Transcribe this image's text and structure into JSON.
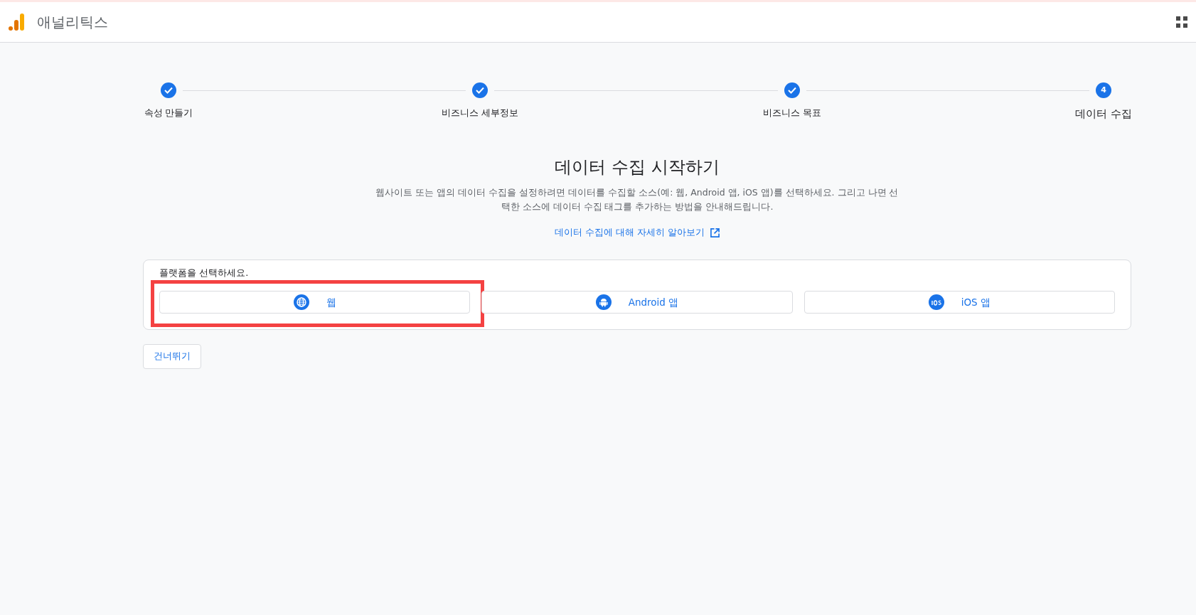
{
  "header": {
    "title": "애널리틱스"
  },
  "steps": [
    {
      "label": "속성 만들기",
      "done": true
    },
    {
      "label": "비즈니스 세부정보",
      "done": true
    },
    {
      "label": "비즈니스 목표",
      "done": true
    },
    {
      "label": "데이터 수집",
      "done": false,
      "number": "4"
    }
  ],
  "intro": {
    "title": "데이터 수집 시작하기",
    "description": "웹사이트 또는 앱의 데이터 수집을 설정하려면 데이터를 수집할 소스(예: 웹, Android 앱, iOS 앱)를 선택하세요. 그리고 나면 선택한 소스에 데이터 수집 태그를 추가하는 방법을 안내해드립니다.",
    "link": "데이터 수집에 대해 자세히 알아보기"
  },
  "platform_card": {
    "label": "플랫폼을 선택하세요.",
    "platforms": [
      {
        "label": "웹",
        "kind": "web",
        "highlighted": true
      },
      {
        "label": "Android 앱",
        "kind": "android",
        "highlighted": false
      },
      {
        "label": "iOS 앱",
        "kind": "ios",
        "highlighted": false
      }
    ]
  },
  "skip_button": "건너뛰기"
}
